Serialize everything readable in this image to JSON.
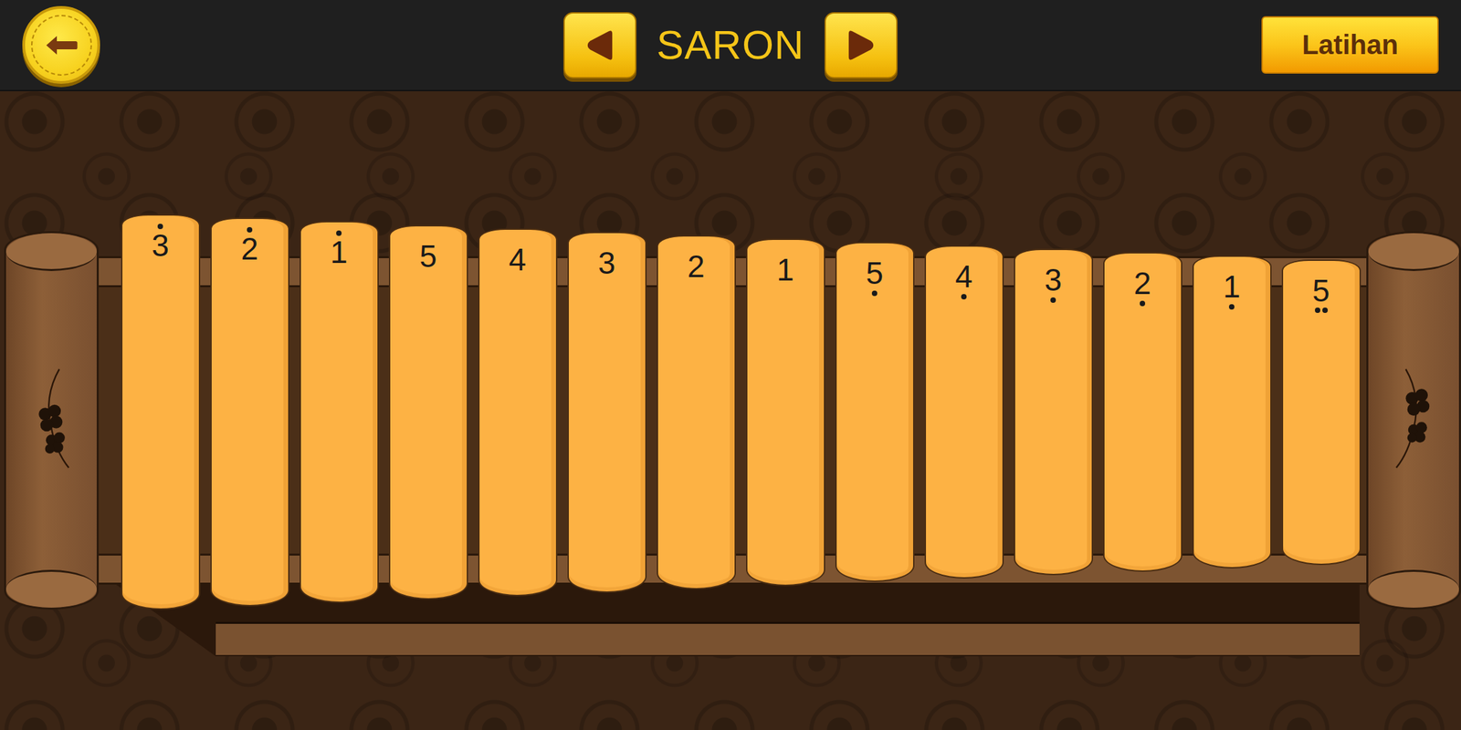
{
  "header": {
    "title": "SARON",
    "practice_button": "Latihan"
  },
  "bars": [
    {
      "note": "3",
      "octave": 1
    },
    {
      "note": "2",
      "octave": 1
    },
    {
      "note": "1",
      "octave": 1
    },
    {
      "note": "5",
      "octave": 0
    },
    {
      "note": "4",
      "octave": 0
    },
    {
      "note": "3",
      "octave": 0
    },
    {
      "note": "2",
      "octave": 0
    },
    {
      "note": "1",
      "octave": 0
    },
    {
      "note": "5",
      "octave": -1
    },
    {
      "note": "4",
      "octave": -1
    },
    {
      "note": "3",
      "octave": -1
    },
    {
      "note": "2",
      "octave": -1
    },
    {
      "note": "1",
      "octave": -1
    },
    {
      "note": "5",
      "octave": -2
    }
  ]
}
